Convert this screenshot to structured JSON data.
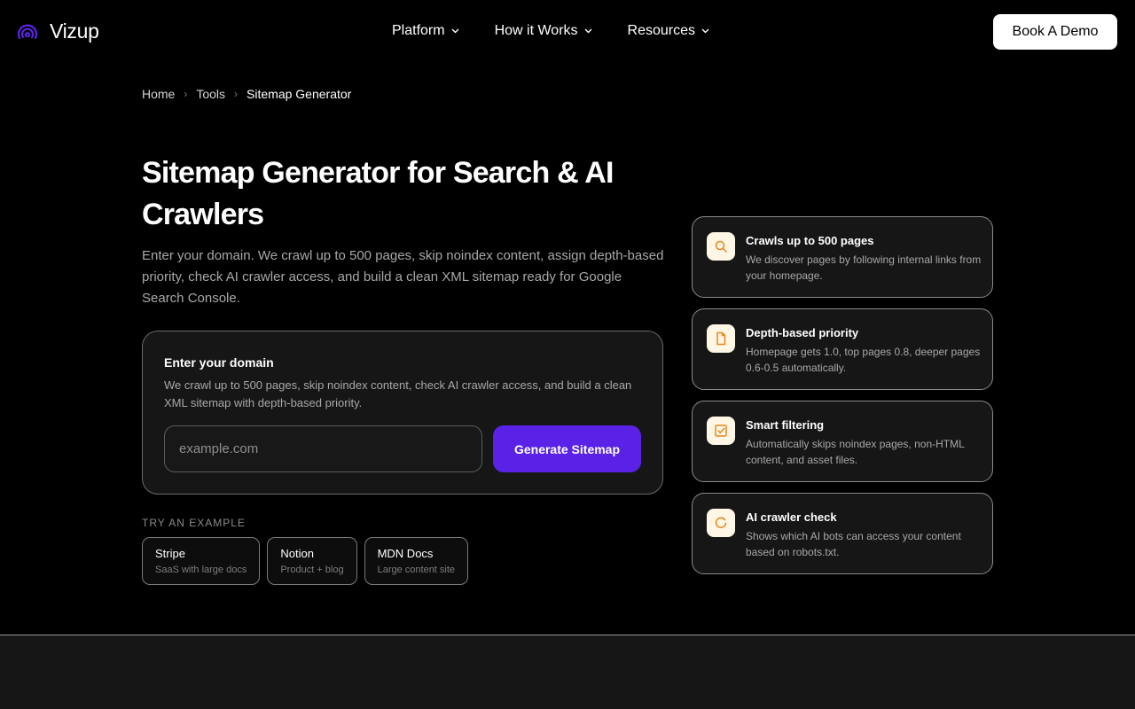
{
  "brand": {
    "name": "Vizup",
    "accent": "#5a22e6"
  },
  "nav": {
    "items": [
      {
        "label": "Platform"
      },
      {
        "label": "How it Works"
      },
      {
        "label": "Resources"
      }
    ],
    "cta_label": "Book A Demo"
  },
  "breadcrumb": {
    "home": "Home",
    "tools": "Tools",
    "current": "Sitemap Generator"
  },
  "hero": {
    "title": "Sitemap Generator for Search & AI Crawlers",
    "intro": "Enter your domain. We crawl up to 500 pages, skip noindex content, assign depth-based priority, check AI crawler access, and build a clean XML sitemap ready for Google Search Console."
  },
  "form": {
    "title": "Enter your domain",
    "description": "We crawl up to 500 pages, skip noindex content, check AI crawler access, and build a clean XML sitemap with depth-based priority.",
    "input_value": "",
    "input_placeholder": "example.com",
    "submit_label": "Generate Sitemap"
  },
  "examples": {
    "label": "TRY AN EXAMPLE",
    "items": [
      {
        "name": "Stripe",
        "sub": "SaaS with large docs"
      },
      {
        "name": "Notion",
        "sub": "Product + blog"
      },
      {
        "name": "MDN Docs",
        "sub": "Large content site"
      }
    ]
  },
  "features": [
    {
      "icon": "search-icon",
      "title": "Crawls up to 500 pages",
      "desc": "We discover pages by following internal links from your homepage."
    },
    {
      "icon": "document-icon",
      "title": "Depth-based priority",
      "desc": "Homepage gets 1.0, top pages 0.8, deeper pages 0.6-0.5 automatically."
    },
    {
      "icon": "checkbox-icon",
      "title": "Smart filtering",
      "desc": "Automatically skips noindex pages, non-HTML content, and asset files."
    },
    {
      "icon": "bot-icon",
      "title": "AI crawler check",
      "desc": "Shows which AI bots can access your content based on robots.txt."
    }
  ],
  "icon_color": "#e8861a"
}
